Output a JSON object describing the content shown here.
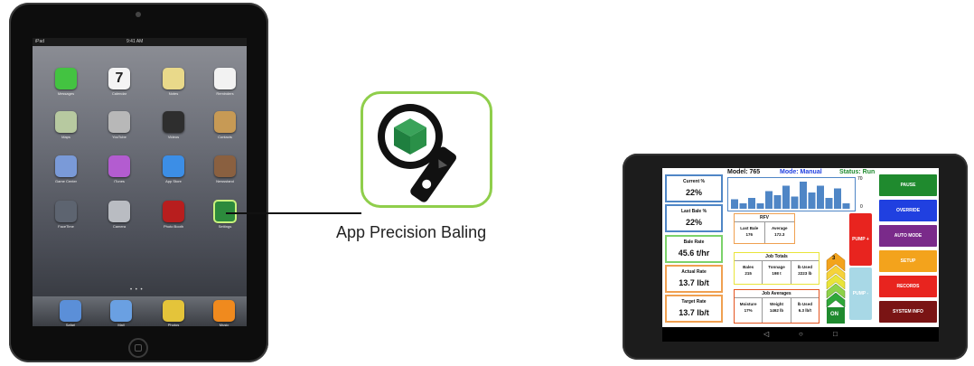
{
  "ipad": {
    "status": {
      "carrier": "iPad",
      "time": "9:41 AM"
    },
    "apps": [
      {
        "label": "Messages",
        "color": "#43c341"
      },
      {
        "label": "Calendar",
        "color": "#f4f4f4",
        "glyph": "7"
      },
      {
        "label": "Notes",
        "color": "#e9d98a"
      },
      {
        "label": "Reminders",
        "color": "#f2f2f2"
      },
      {
        "label": "Maps",
        "color": "#b7c9a0"
      },
      {
        "label": "YouTube",
        "color": "#b8b8b8"
      },
      {
        "label": "Videos",
        "color": "#2e2e2e"
      },
      {
        "label": "Contacts",
        "color": "#c79a55"
      },
      {
        "label": "Game Center",
        "color": "#7a9ad8"
      },
      {
        "label": "iTunes",
        "color": "#b35cd0"
      },
      {
        "label": "App Store",
        "color": "#3c8ee6"
      },
      {
        "label": "Newsstand",
        "color": "#8a6040"
      },
      {
        "label": "FaceTime",
        "color": "#5d6470"
      },
      {
        "label": "Camera",
        "color": "#b9bcc2"
      },
      {
        "label": "Photo Booth",
        "color": "#b81e1e"
      },
      {
        "label": "Settings",
        "color": "#2c8a3c"
      }
    ],
    "dock": [
      {
        "label": "Safari",
        "color": "#5b8fd8"
      },
      {
        "label": "Mail",
        "color": "#6aa0e2"
      },
      {
        "label": "Photos",
        "color": "#e4c43a"
      },
      {
        "label": "Music",
        "color": "#f08a1e"
      }
    ],
    "page_dots": "• • •"
  },
  "app_icon": {
    "caption": "App Precision Baling"
  },
  "tablet": {
    "header": {
      "model": "Model: 765",
      "mode": "Mode: Manual",
      "status": "Status: Run"
    },
    "chart": {
      "ymax": "70",
      "ymin": "0",
      "bars": [
        0.35,
        0.2,
        0.4,
        0.2,
        0.65,
        0.5,
        0.85,
        0.45,
        1.0,
        0.6,
        0.85,
        0.4,
        0.75,
        0.2
      ]
    },
    "left_boxes": [
      {
        "label": "Current %",
        "value": "22%",
        "color": "#4f86c6"
      },
      {
        "label": "Last Bale %",
        "value": "22%",
        "color": "#4f86c6"
      },
      {
        "label": "Bale Rate",
        "value": "45.6 t/hr",
        "color": "#7bd26a"
      },
      {
        "label": "Actual Rate",
        "value": "13.7 lb/t",
        "color": "#f0a050"
      },
      {
        "label": "Target Rate",
        "value": "13.7 lb/t",
        "color": "#f0a050"
      }
    ],
    "rfv": {
      "title": "RFV",
      "cols": [
        {
          "h": "Last Bale",
          "v": "176"
        },
        {
          "h": "Average",
          "v": "172.3"
        }
      ]
    },
    "job_totals": {
      "title": "Job Totals",
      "cols": [
        {
          "h": "Bales",
          "v": "215"
        },
        {
          "h": "Tonnage",
          "v": "198 t"
        },
        {
          "h": "lb Used",
          "v": "2223 lb"
        }
      ]
    },
    "job_averages": {
      "title": "Job Averages",
      "cols": [
        {
          "h": "Moisture",
          "v": "17%"
        },
        {
          "h": "Weight",
          "v": "1462 lb"
        },
        {
          "h": "lb Used",
          "v": "6.3 lb/t"
        }
      ]
    },
    "pump_plus": "PUMP +",
    "pump_minus": "PUMP -",
    "level": "3",
    "on_label": "ON",
    "buttons": [
      {
        "label": "PAUSE",
        "color": "#1f8a2e"
      },
      {
        "label": "OVERRIDE",
        "color": "#2040e0"
      },
      {
        "label": "AUTO MODE",
        "color": "#7a2a8a"
      },
      {
        "label": "SETUP",
        "color": "#f3a31c"
      },
      {
        "label": "RECORDS",
        "color": "#e8241f"
      },
      {
        "label": "SYSTEM INFO",
        "color": "#7a1414"
      }
    ],
    "nav": {
      "back": "◁",
      "home": "○",
      "recent": "□"
    }
  }
}
